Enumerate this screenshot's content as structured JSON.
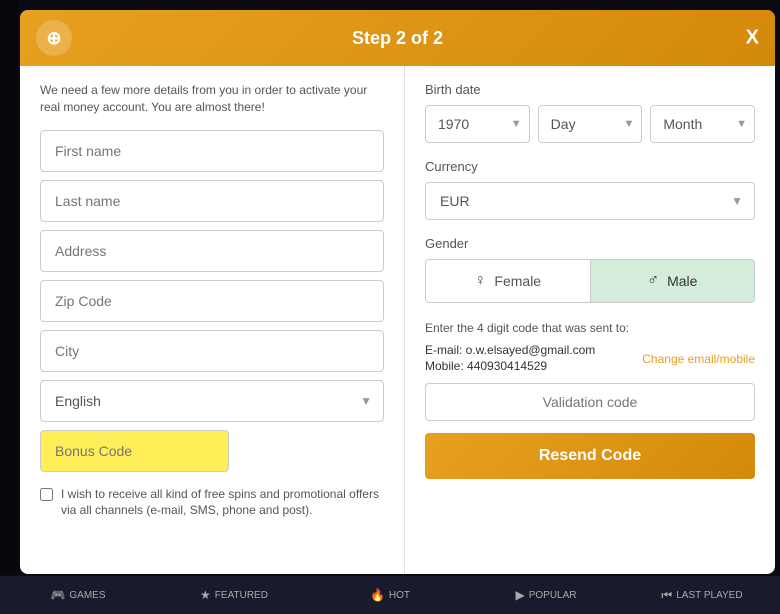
{
  "modal": {
    "title": "Step 2 of 2",
    "close_label": "X",
    "description": "We need a few more details from you in order to activate your real money account. You are almost there!"
  },
  "form": {
    "first_name_placeholder": "First name",
    "last_name_placeholder": "Last name",
    "address_placeholder": "Address",
    "zip_placeholder": "Zip Code",
    "city_placeholder": "City",
    "language_value": "English",
    "bonus_code_placeholder": "Bonus Code",
    "checkbox_label": "I wish to receive all kind of free spins and promotional offers via all channels (e-mail, SMS, phone and post)."
  },
  "birth_date": {
    "label": "Birth date",
    "year_value": "1970",
    "day_placeholder": "Day",
    "month_placeholder": "Month"
  },
  "currency": {
    "label": "Currency",
    "value": "EUR"
  },
  "gender": {
    "label": "Gender",
    "female_label": "Female",
    "male_label": "Male"
  },
  "validation": {
    "intro_text": "Enter the 4 digit code that was sent to:",
    "email_label": "E-mail: o.w.elsayed@gmail.com",
    "mobile_label": "Mobile: 440930414529",
    "change_link": "Change email/mobile",
    "input_placeholder": "Validation code",
    "resend_label": "Resend Code"
  },
  "bottom_nav": {
    "items": [
      {
        "label": "GAMES",
        "icon": "🎮"
      },
      {
        "label": "FEATURED",
        "icon": "🔥"
      },
      {
        "label": "HOT",
        "icon": "🔥"
      },
      {
        "label": "POPULAR",
        "icon": "▶"
      },
      {
        "label": "LAST PLAYED",
        "icon": "⏮"
      }
    ]
  }
}
